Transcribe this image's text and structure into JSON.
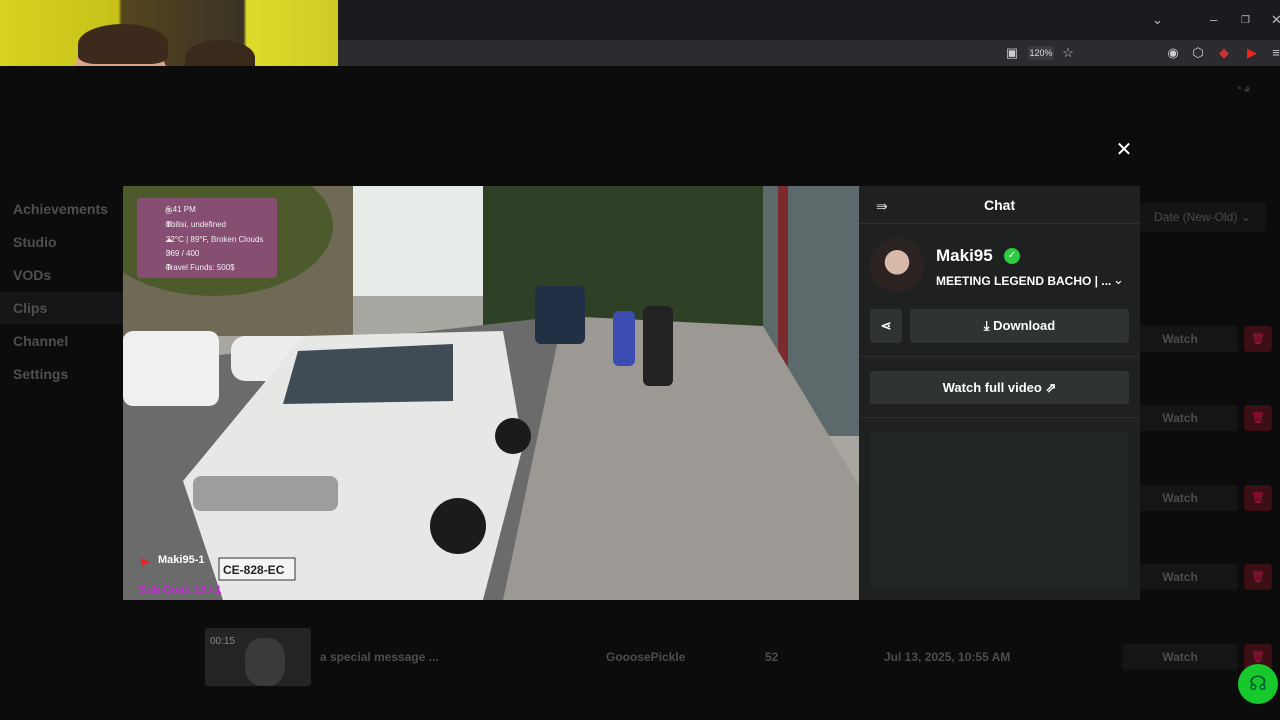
{
  "browser": {
    "zoom": "120%",
    "window_controls": {
      "minimize": "–",
      "restore": "❐",
      "close": "✕",
      "tabs_list": "⌄"
    }
  },
  "sidebar": {
    "items": [
      {
        "label": "Achievements"
      },
      {
        "label": "Studio"
      },
      {
        "label": "VODs"
      },
      {
        "label": "Clips"
      },
      {
        "label": "Channel"
      },
      {
        "label": "Settings"
      }
    ]
  },
  "filters": {
    "sort": "Date (New-Old)"
  },
  "clips_table": {
    "row_buttons": [
      {
        "watch": "Watch"
      },
      {
        "watch": "Watch"
      },
      {
        "watch": "Watch"
      },
      {
        "watch": "Watch"
      },
      {
        "watch": "Watch"
      }
    ],
    "visible_row": {
      "duration": "00:15",
      "title": "a special message ...",
      "clipper": "GooosePickle",
      "views": "52",
      "date": "Jul 13, 2025, 10:55 AM",
      "watch": "Watch"
    }
  },
  "video": {
    "overlay": {
      "time": "6:41 PM",
      "location": "Tbilisi, undefined",
      "weather": "32°C | 89°F, Broken Clouds",
      "counter": "369 / 400",
      "travel_funds": "Travel Funds: 500$"
    },
    "channel_tag": "Maki95-1",
    "sub_goal": "Sub Goal: 15 / 1",
    "plate": "CE-828-EC"
  },
  "chat_panel": {
    "title": "Chat",
    "streamer": "Maki95",
    "stream_title": "MEETING LEGEND BACHO | ...",
    "download": "Download",
    "watch_full": "Watch full video"
  },
  "colors": {
    "verified": "#2ecc40",
    "help": "#16c82c",
    "delete": "#3c0f14"
  }
}
